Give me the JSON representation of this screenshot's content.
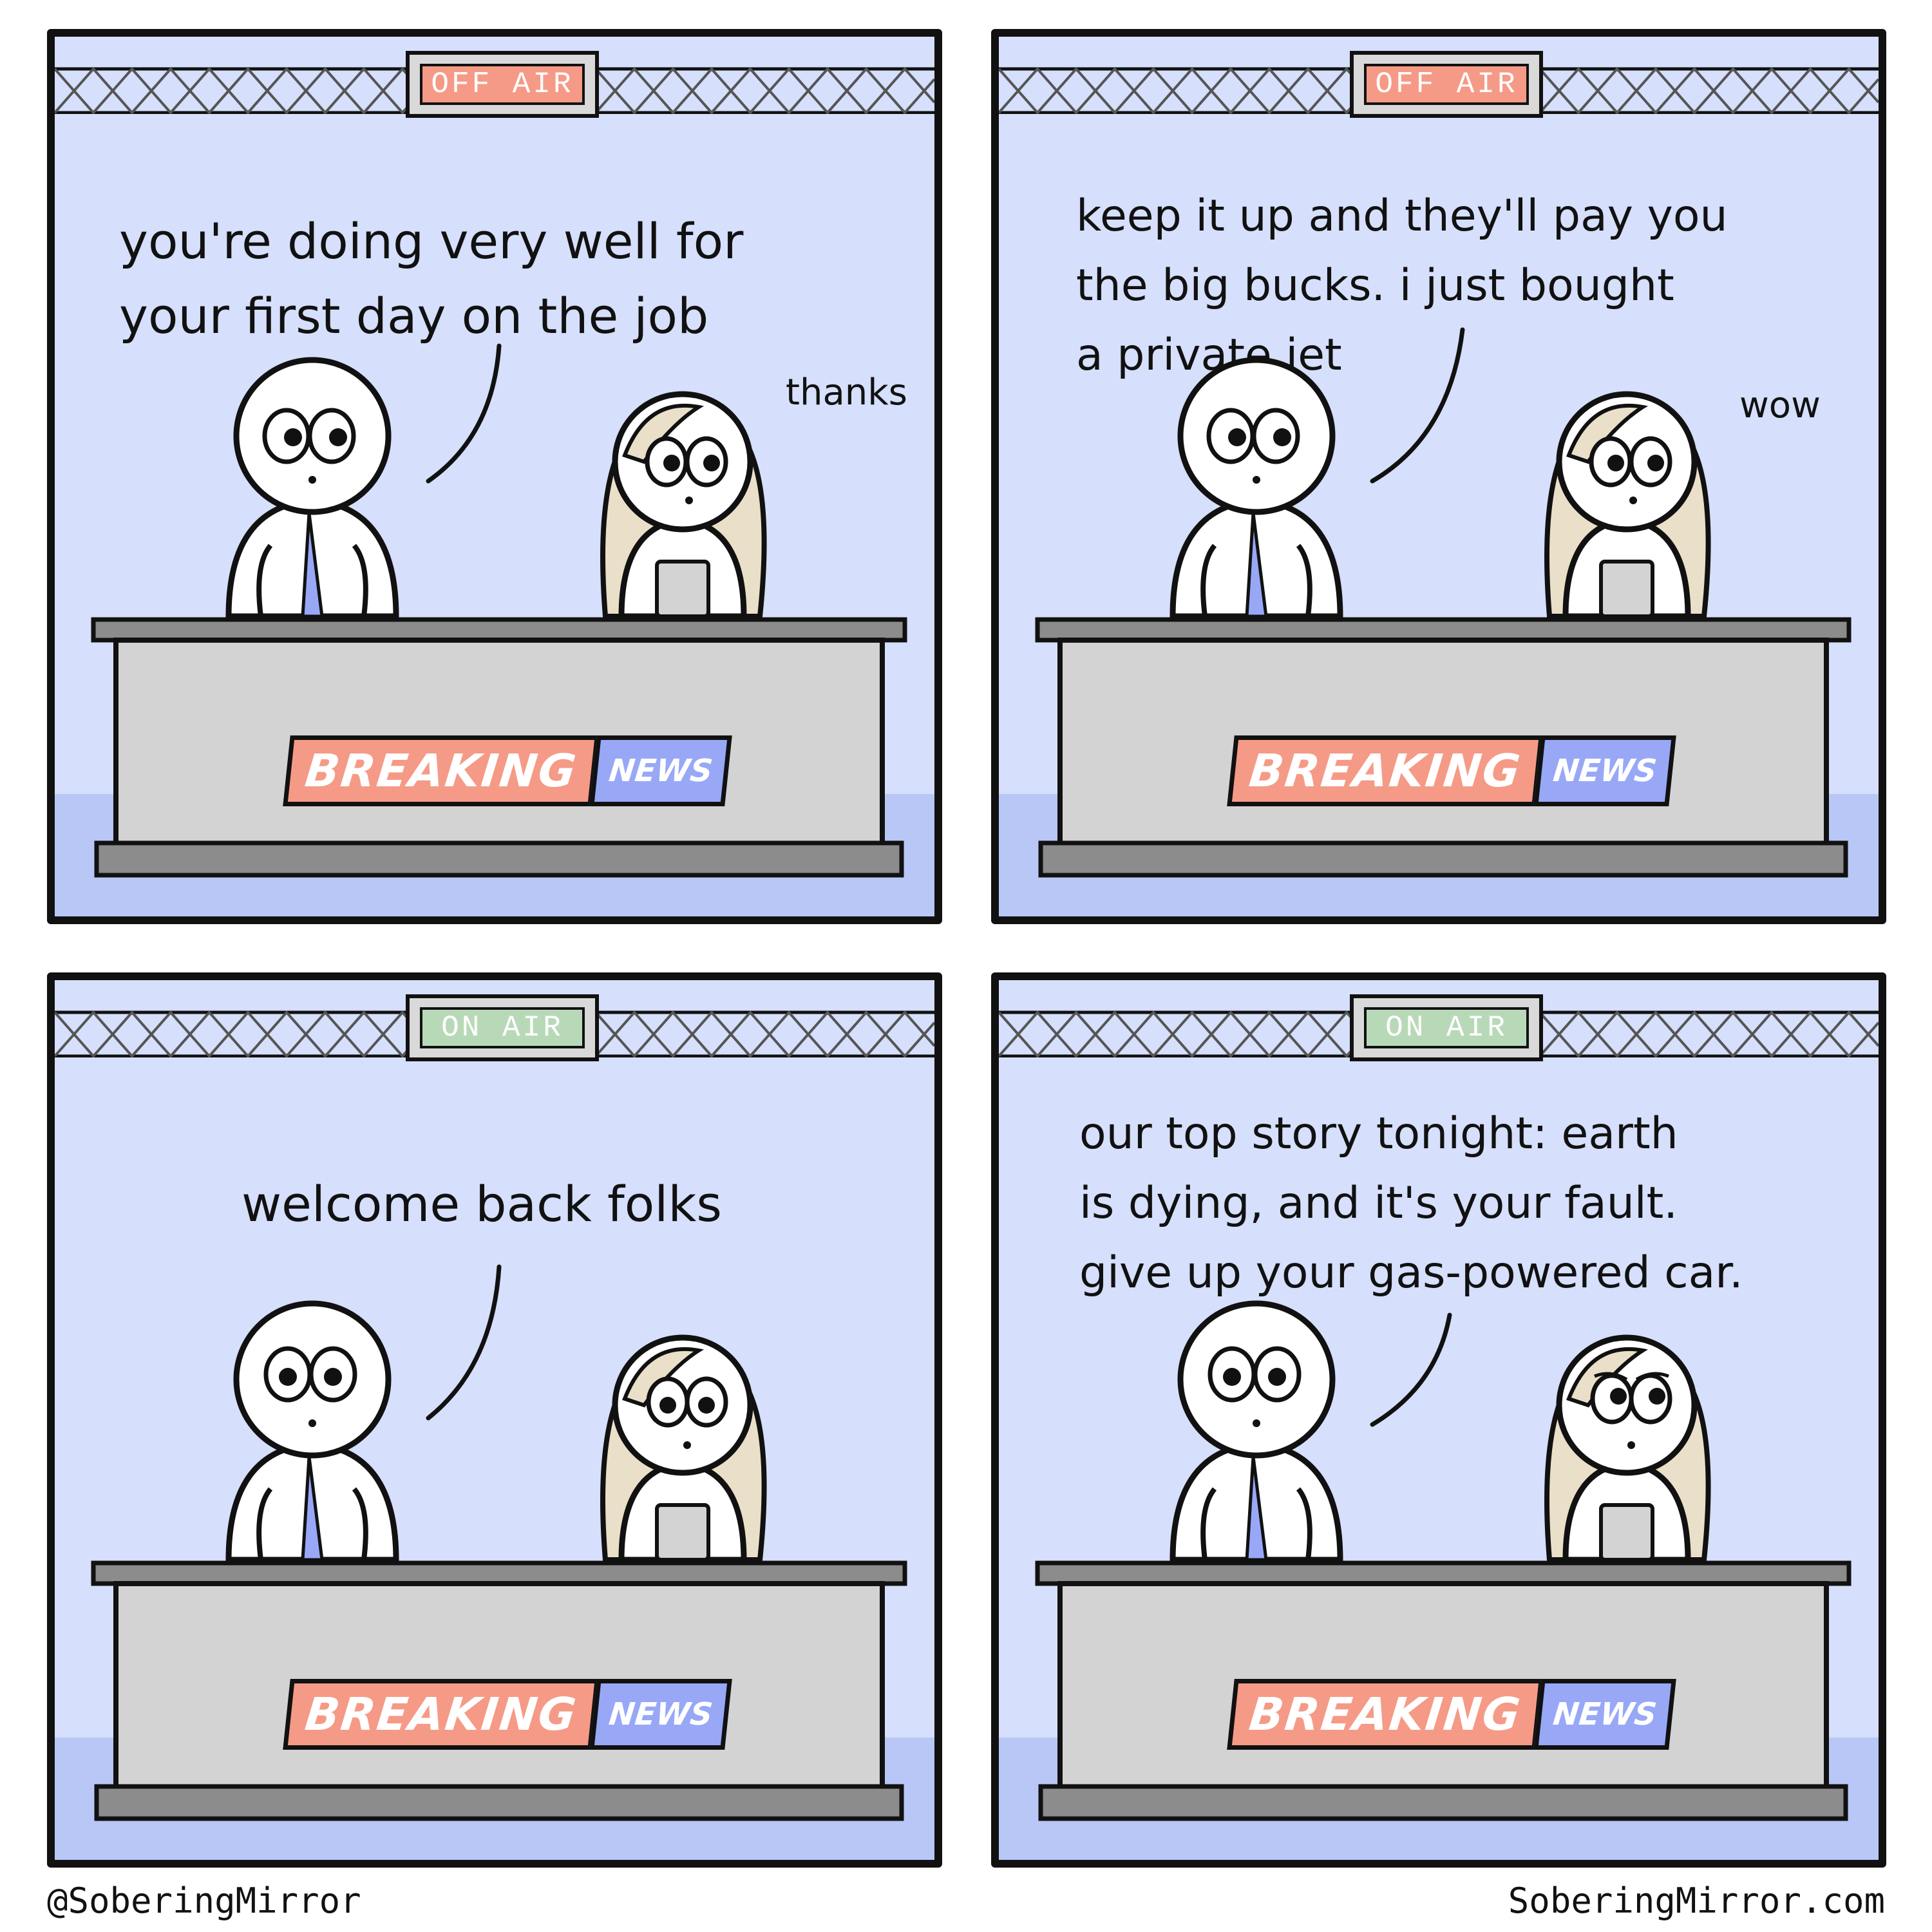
{
  "comic": {
    "panels": [
      {
        "sign": "OFF AIR",
        "sign_state": "off",
        "speech": "you're doing very well for\nyour first day on the job",
        "reply": "thanks",
        "ticker_left": "BREAKING",
        "ticker_right": "NEWS"
      },
      {
        "sign": "OFF AIR",
        "sign_state": "off",
        "speech": "keep it up and they'll pay you\nthe big bucks. i just bought\na private jet",
        "reply": "wow",
        "ticker_left": "BREAKING",
        "ticker_right": "NEWS"
      },
      {
        "sign": "ON AIR",
        "sign_state": "on",
        "speech": "welcome back folks",
        "reply": "",
        "ticker_left": "BREAKING",
        "ticker_right": "NEWS"
      },
      {
        "sign": "ON AIR",
        "sign_state": "on",
        "speech": "our top story tonight: earth\nis dying, and it's your fault.\ngive up your gas-powered car.",
        "reply": "",
        "ticker_left": "BREAKING",
        "ticker_right": "NEWS"
      }
    ],
    "credit_left": "@SoberingMirror",
    "credit_right": "SoberingMirror.com"
  },
  "colors": {
    "sky": "#d6dffb",
    "floor": "#b9c7f7",
    "off_air": "#f59a86",
    "on_air": "#b8d9b8",
    "desk": "#d3d3d3",
    "desk_top": "#8c8c8c",
    "hair": "#eadfc8",
    "tie": "#98a8f6"
  }
}
